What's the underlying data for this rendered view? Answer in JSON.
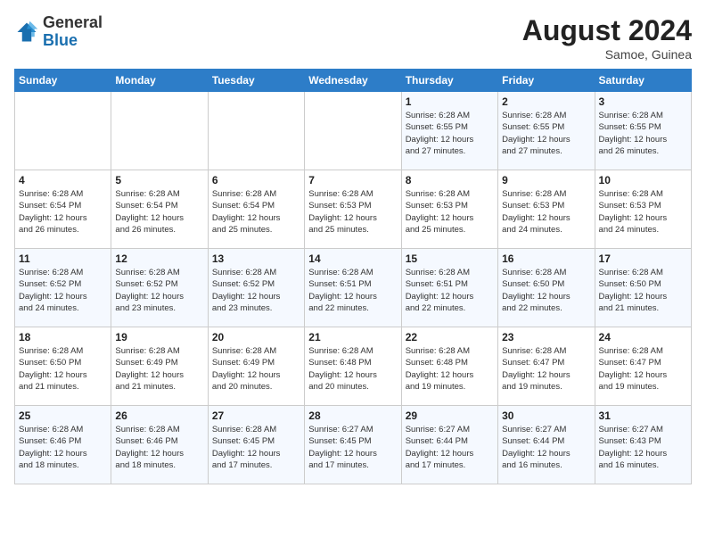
{
  "header": {
    "logo_general": "General",
    "logo_blue": "Blue",
    "month_year": "August 2024",
    "location": "Samoe, Guinea"
  },
  "weekdays": [
    "Sunday",
    "Monday",
    "Tuesday",
    "Wednesday",
    "Thursday",
    "Friday",
    "Saturday"
  ],
  "weeks": [
    [
      {
        "day": "",
        "info": ""
      },
      {
        "day": "",
        "info": ""
      },
      {
        "day": "",
        "info": ""
      },
      {
        "day": "",
        "info": ""
      },
      {
        "day": "1",
        "info": "Sunrise: 6:28 AM\nSunset: 6:55 PM\nDaylight: 12 hours\nand 27 minutes."
      },
      {
        "day": "2",
        "info": "Sunrise: 6:28 AM\nSunset: 6:55 PM\nDaylight: 12 hours\nand 27 minutes."
      },
      {
        "day": "3",
        "info": "Sunrise: 6:28 AM\nSunset: 6:55 PM\nDaylight: 12 hours\nand 26 minutes."
      }
    ],
    [
      {
        "day": "4",
        "info": "Sunrise: 6:28 AM\nSunset: 6:54 PM\nDaylight: 12 hours\nand 26 minutes."
      },
      {
        "day": "5",
        "info": "Sunrise: 6:28 AM\nSunset: 6:54 PM\nDaylight: 12 hours\nand 26 minutes."
      },
      {
        "day": "6",
        "info": "Sunrise: 6:28 AM\nSunset: 6:54 PM\nDaylight: 12 hours\nand 25 minutes."
      },
      {
        "day": "7",
        "info": "Sunrise: 6:28 AM\nSunset: 6:53 PM\nDaylight: 12 hours\nand 25 minutes."
      },
      {
        "day": "8",
        "info": "Sunrise: 6:28 AM\nSunset: 6:53 PM\nDaylight: 12 hours\nand 25 minutes."
      },
      {
        "day": "9",
        "info": "Sunrise: 6:28 AM\nSunset: 6:53 PM\nDaylight: 12 hours\nand 24 minutes."
      },
      {
        "day": "10",
        "info": "Sunrise: 6:28 AM\nSunset: 6:53 PM\nDaylight: 12 hours\nand 24 minutes."
      }
    ],
    [
      {
        "day": "11",
        "info": "Sunrise: 6:28 AM\nSunset: 6:52 PM\nDaylight: 12 hours\nand 24 minutes."
      },
      {
        "day": "12",
        "info": "Sunrise: 6:28 AM\nSunset: 6:52 PM\nDaylight: 12 hours\nand 23 minutes."
      },
      {
        "day": "13",
        "info": "Sunrise: 6:28 AM\nSunset: 6:52 PM\nDaylight: 12 hours\nand 23 minutes."
      },
      {
        "day": "14",
        "info": "Sunrise: 6:28 AM\nSunset: 6:51 PM\nDaylight: 12 hours\nand 22 minutes."
      },
      {
        "day": "15",
        "info": "Sunrise: 6:28 AM\nSunset: 6:51 PM\nDaylight: 12 hours\nand 22 minutes."
      },
      {
        "day": "16",
        "info": "Sunrise: 6:28 AM\nSunset: 6:50 PM\nDaylight: 12 hours\nand 22 minutes."
      },
      {
        "day": "17",
        "info": "Sunrise: 6:28 AM\nSunset: 6:50 PM\nDaylight: 12 hours\nand 21 minutes."
      }
    ],
    [
      {
        "day": "18",
        "info": "Sunrise: 6:28 AM\nSunset: 6:50 PM\nDaylight: 12 hours\nand 21 minutes."
      },
      {
        "day": "19",
        "info": "Sunrise: 6:28 AM\nSunset: 6:49 PM\nDaylight: 12 hours\nand 21 minutes."
      },
      {
        "day": "20",
        "info": "Sunrise: 6:28 AM\nSunset: 6:49 PM\nDaylight: 12 hours\nand 20 minutes."
      },
      {
        "day": "21",
        "info": "Sunrise: 6:28 AM\nSunset: 6:48 PM\nDaylight: 12 hours\nand 20 minutes."
      },
      {
        "day": "22",
        "info": "Sunrise: 6:28 AM\nSunset: 6:48 PM\nDaylight: 12 hours\nand 19 minutes."
      },
      {
        "day": "23",
        "info": "Sunrise: 6:28 AM\nSunset: 6:47 PM\nDaylight: 12 hours\nand 19 minutes."
      },
      {
        "day": "24",
        "info": "Sunrise: 6:28 AM\nSunset: 6:47 PM\nDaylight: 12 hours\nand 19 minutes."
      }
    ],
    [
      {
        "day": "25",
        "info": "Sunrise: 6:28 AM\nSunset: 6:46 PM\nDaylight: 12 hours\nand 18 minutes."
      },
      {
        "day": "26",
        "info": "Sunrise: 6:28 AM\nSunset: 6:46 PM\nDaylight: 12 hours\nand 18 minutes."
      },
      {
        "day": "27",
        "info": "Sunrise: 6:28 AM\nSunset: 6:45 PM\nDaylight: 12 hours\nand 17 minutes."
      },
      {
        "day": "28",
        "info": "Sunrise: 6:27 AM\nSunset: 6:45 PM\nDaylight: 12 hours\nand 17 minutes."
      },
      {
        "day": "29",
        "info": "Sunrise: 6:27 AM\nSunset: 6:44 PM\nDaylight: 12 hours\nand 17 minutes."
      },
      {
        "day": "30",
        "info": "Sunrise: 6:27 AM\nSunset: 6:44 PM\nDaylight: 12 hours\nand 16 minutes."
      },
      {
        "day": "31",
        "info": "Sunrise: 6:27 AM\nSunset: 6:43 PM\nDaylight: 12 hours\nand 16 minutes."
      }
    ]
  ]
}
